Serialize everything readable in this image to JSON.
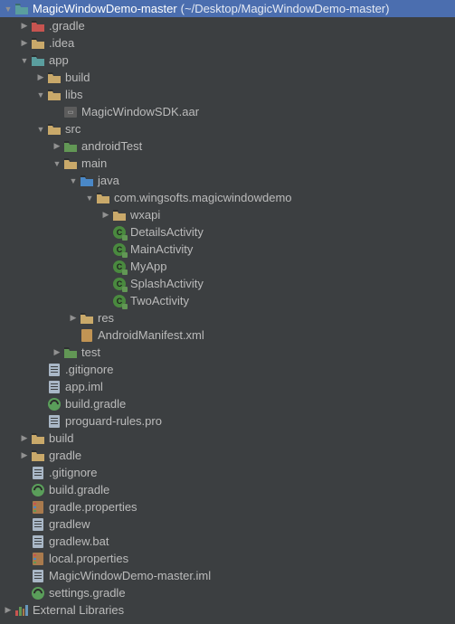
{
  "header": {
    "project_name": "MagicWindowDemo-master",
    "project_path": "(~/Desktop/MagicWindowDemo-master)"
  },
  "tree": [
    {
      "indent": 1,
      "arrow": "right",
      "icon": "folder-red",
      "name": "gradle-folder",
      "label": ".gradle"
    },
    {
      "indent": 1,
      "arrow": "right",
      "icon": "folder-yellow",
      "name": "idea-folder",
      "label": ".idea"
    },
    {
      "indent": 1,
      "arrow": "down",
      "icon": "folder-teal",
      "name": "app-module",
      "label": "app"
    },
    {
      "indent": 2,
      "arrow": "right",
      "icon": "folder-yellow",
      "name": "build-folder",
      "label": "build"
    },
    {
      "indent": 2,
      "arrow": "down",
      "icon": "folder-yellow",
      "name": "libs-folder",
      "label": "libs"
    },
    {
      "indent": 3,
      "arrow": "",
      "icon": "aar",
      "name": "aar-file",
      "label": "MagicWindowSDK.aar"
    },
    {
      "indent": 2,
      "arrow": "down",
      "icon": "folder-yellow",
      "name": "src-folder",
      "label": "src"
    },
    {
      "indent": 3,
      "arrow": "right",
      "icon": "folder-green",
      "name": "androidtest-folder",
      "label": "androidTest"
    },
    {
      "indent": 3,
      "arrow": "down",
      "icon": "folder-yellow",
      "name": "main-folder",
      "label": "main"
    },
    {
      "indent": 4,
      "arrow": "down",
      "icon": "folder-blue",
      "name": "java-folder",
      "label": "java"
    },
    {
      "indent": 5,
      "arrow": "down",
      "icon": "folder-yellow",
      "name": "package-folder",
      "label": "com.wingsofts.magicwindowdemo"
    },
    {
      "indent": 6,
      "arrow": "right",
      "icon": "folder-yellow",
      "name": "wxapi-folder",
      "label": "wxapi"
    },
    {
      "indent": 6,
      "arrow": "",
      "icon": "class",
      "name": "class-details",
      "label": "DetailsActivity"
    },
    {
      "indent": 6,
      "arrow": "",
      "icon": "class",
      "name": "class-main",
      "label": "MainActivity"
    },
    {
      "indent": 6,
      "arrow": "",
      "icon": "class",
      "name": "class-myapp",
      "label": "MyApp"
    },
    {
      "indent": 6,
      "arrow": "",
      "icon": "class",
      "name": "class-splash",
      "label": "SplashActivity"
    },
    {
      "indent": 6,
      "arrow": "",
      "icon": "class",
      "name": "class-two",
      "label": "TwoActivity"
    },
    {
      "indent": 4,
      "arrow": "right",
      "icon": "folder-yellow",
      "name": "res-folder",
      "label": "res"
    },
    {
      "indent": 4,
      "arrow": "",
      "icon": "xml",
      "name": "manifest-file",
      "label": "AndroidManifest.xml"
    },
    {
      "indent": 3,
      "arrow": "right",
      "icon": "folder-green",
      "name": "test-folder",
      "label": "test"
    },
    {
      "indent": 2,
      "arrow": "",
      "icon": "file",
      "name": "gitignore-app",
      "label": ".gitignore"
    },
    {
      "indent": 2,
      "arrow": "",
      "icon": "file",
      "name": "app-iml",
      "label": "app.iml"
    },
    {
      "indent": 2,
      "arrow": "",
      "icon": "gradle",
      "name": "build-gradle-app",
      "label": "build.gradle"
    },
    {
      "indent": 2,
      "arrow": "",
      "icon": "file",
      "name": "proguard-file",
      "label": "proguard-rules.pro"
    },
    {
      "indent": 1,
      "arrow": "right",
      "icon": "folder-yellow",
      "name": "build-root",
      "label": "build"
    },
    {
      "indent": 1,
      "arrow": "right",
      "icon": "folder-yellow",
      "name": "gradle-root",
      "label": "gradle"
    },
    {
      "indent": 1,
      "arrow": "",
      "icon": "file",
      "name": "gitignore-root",
      "label": ".gitignore"
    },
    {
      "indent": 1,
      "arrow": "",
      "icon": "gradle",
      "name": "build-gradle-root",
      "label": "build.gradle"
    },
    {
      "indent": 1,
      "arrow": "",
      "icon": "prop",
      "name": "gradle-properties",
      "label": "gradle.properties"
    },
    {
      "indent": 1,
      "arrow": "",
      "icon": "file",
      "name": "gradlew",
      "label": "gradlew"
    },
    {
      "indent": 1,
      "arrow": "",
      "icon": "file",
      "name": "gradlew-bat",
      "label": "gradlew.bat"
    },
    {
      "indent": 1,
      "arrow": "",
      "icon": "prop",
      "name": "local-properties",
      "label": "local.properties"
    },
    {
      "indent": 1,
      "arrow": "",
      "icon": "file",
      "name": "project-iml",
      "label": "MagicWindowDemo-master.iml"
    },
    {
      "indent": 1,
      "arrow": "",
      "icon": "gradle",
      "name": "settings-gradle",
      "label": "settings.gradle"
    }
  ],
  "external_libraries_label": "External Libraries"
}
